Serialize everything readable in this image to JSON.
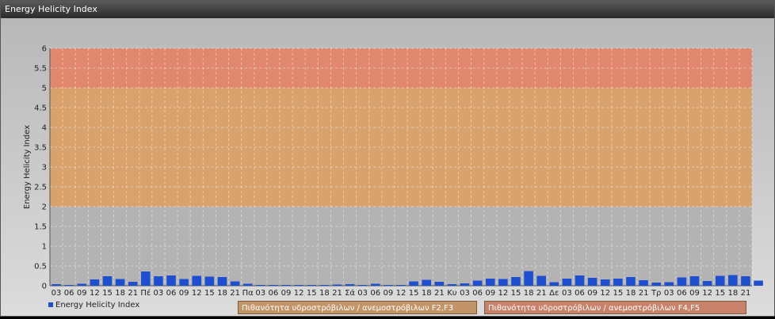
{
  "window": {
    "title": "Energy Helicity Index"
  },
  "legend": {
    "series_label": "Energy Helicity Index",
    "band_f2f3": "Πιθανότητα υδροστρόβιλων / ανεμοστρόβιλων F2,F3",
    "band_f4f5": "Πιθανότητα υδροστρόβιλων / ανεμοστρόβιλων F4,F5"
  },
  "colors": {
    "bar": "#1f4fd1",
    "band_low": "#b3b3b3",
    "band_mid": "#d9a16c",
    "band_high": "#e0876d"
  },
  "chart_data": {
    "type": "bar",
    "title": "",
    "xlabel": "",
    "ylabel": "Energy Helicity Index",
    "ylim": [
      0,
      6
    ],
    "yticks": [
      "0",
      "0.5",
      "1",
      "1.5",
      "2",
      "2.5",
      "3",
      "3.5",
      "4",
      "4.5",
      "5",
      "5.5",
      "6"
    ],
    "grid": true,
    "legend_position": "bottom-left",
    "bands": [
      {
        "from": 0,
        "to": 2,
        "color": "#b3b3b3"
      },
      {
        "from": 2,
        "to": 5,
        "color": "#d9a16c",
        "label": "Πιθανότητα υδροστρόβιλων / ανεμοστρόβιλων F2,F3"
      },
      {
        "from": 5,
        "to": 6,
        "color": "#e0876d",
        "label": "Πιθανότητα υδροστρόβιλων / ανεμοστρόβιλων F4,F5"
      }
    ],
    "categories": [
      "03",
      "06",
      "09",
      "12",
      "15",
      "18",
      "21",
      "Πέ",
      "03",
      "06",
      "09",
      "12",
      "15",
      "18",
      "21",
      "Πα",
      "03",
      "06",
      "09",
      "12",
      "15",
      "18",
      "21",
      "Σά",
      "03",
      "06",
      "09",
      "12",
      "15",
      "18",
      "21",
      "Κυ",
      "03",
      "06",
      "09",
      "12",
      "15",
      "18",
      "21",
      "Δε",
      "03",
      "06",
      "09",
      "12",
      "15",
      "18",
      "21",
      "Τρ",
      "03",
      "06",
      "09",
      "12",
      "15",
      "18",
      "21"
    ],
    "series": [
      {
        "name": "Energy Helicity Index",
        "values": [
          0.04,
          0.02,
          0.05,
          0.16,
          0.24,
          0.17,
          0.1,
          0.36,
          0.24,
          0.26,
          0.17,
          0.25,
          0.23,
          0.22,
          0.11,
          0.05,
          0.02,
          0.02,
          0.02,
          0.02,
          0.02,
          0.02,
          0.03,
          0.04,
          0.02,
          0.05,
          0.02,
          0.02,
          0.11,
          0.15,
          0.1,
          0.04,
          0.06,
          0.13,
          0.18,
          0.17,
          0.22,
          0.37,
          0.25,
          0.09,
          0.18,
          0.26,
          0.2,
          0.16,
          0.18,
          0.22,
          0.14,
          0.08,
          0.09,
          0.21,
          0.24,
          0.12,
          0.25,
          0.27,
          0.24,
          0.13
        ]
      }
    ]
  }
}
